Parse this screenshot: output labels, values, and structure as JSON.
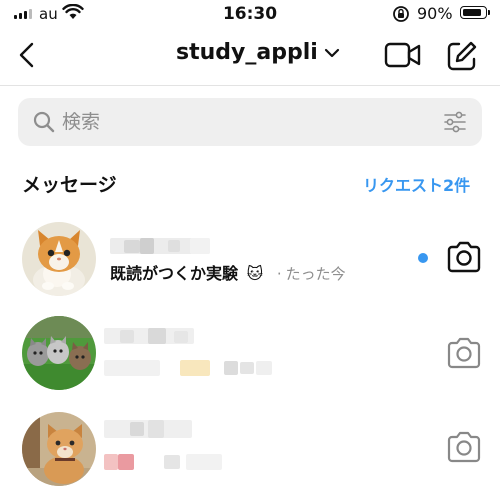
{
  "status_bar": {
    "carrier": "au",
    "time": "16:30",
    "battery_text": "90%",
    "battery_level": 0.9
  },
  "header": {
    "username": "study_appli",
    "back_icon": "chevron-left-icon",
    "video_icon": "video-camera-icon",
    "compose_icon": "compose-icon"
  },
  "search": {
    "placeholder": "検索",
    "value": ""
  },
  "section": {
    "title": "メッセージ",
    "requests_label": "リクエスト2件"
  },
  "threads": [
    {
      "preview": "既読がつくか実験",
      "emoji": "🐱",
      "separator": "·",
      "time": "たった今",
      "unread": true,
      "avatar": "kitten"
    },
    {
      "preview": "",
      "unread": false,
      "avatar": "kittens-group"
    },
    {
      "preview": "",
      "unread": false,
      "avatar": "cat-portrait"
    }
  ],
  "colors": {
    "accent": "#3897f0",
    "muted": "#8e8e8e"
  }
}
